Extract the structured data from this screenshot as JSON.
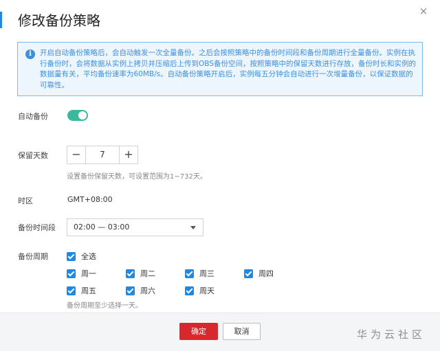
{
  "dialog": {
    "title": "修改备份策略",
    "close_glyph": "×"
  },
  "info": {
    "icon_glyph": "i",
    "text": "开启自动备份策略后，会自动触发一次全量备份。之后会按照策略中的备份时间段和备份周期进行全量备份。实例在执行备份时，会将数据从实例上拷贝并压缩后上传到OBS备份空间，按照策略中的保留天数进行存放，备份时长和实例的数据量有关，平均备份速率为60MB/s。自动备份策略开启后，实例每五分钟会自动进行一次增量备份，以保证数据的可靠性。"
  },
  "auto_backup": {
    "label": "自动备份",
    "enabled": true
  },
  "retention": {
    "label": "保留天数",
    "minus": "−",
    "value": "7",
    "plus": "+",
    "hint": "设置备份保留天数，可设置范围为1~732天。"
  },
  "timezone": {
    "label": "时区",
    "value": "GMT+08:00"
  },
  "time_window": {
    "label": "备份时间段",
    "value": "02:00 — 03:00"
  },
  "period": {
    "label": "备份周期",
    "select_all": "全选",
    "days": [
      "周一",
      "周二",
      "周三",
      "周四",
      "周五",
      "周六",
      "周天"
    ],
    "hint": "备份周期至少选择一天。"
  },
  "footer": {
    "ok_label": "确定",
    "cancel_label": "取消",
    "watermark": "华为云社区"
  },
  "colors": {
    "accent": "#1e88e5",
    "toggle_on": "#3cb89d",
    "primary_button": "#d7282f",
    "info_text": "#3d8fe0"
  }
}
